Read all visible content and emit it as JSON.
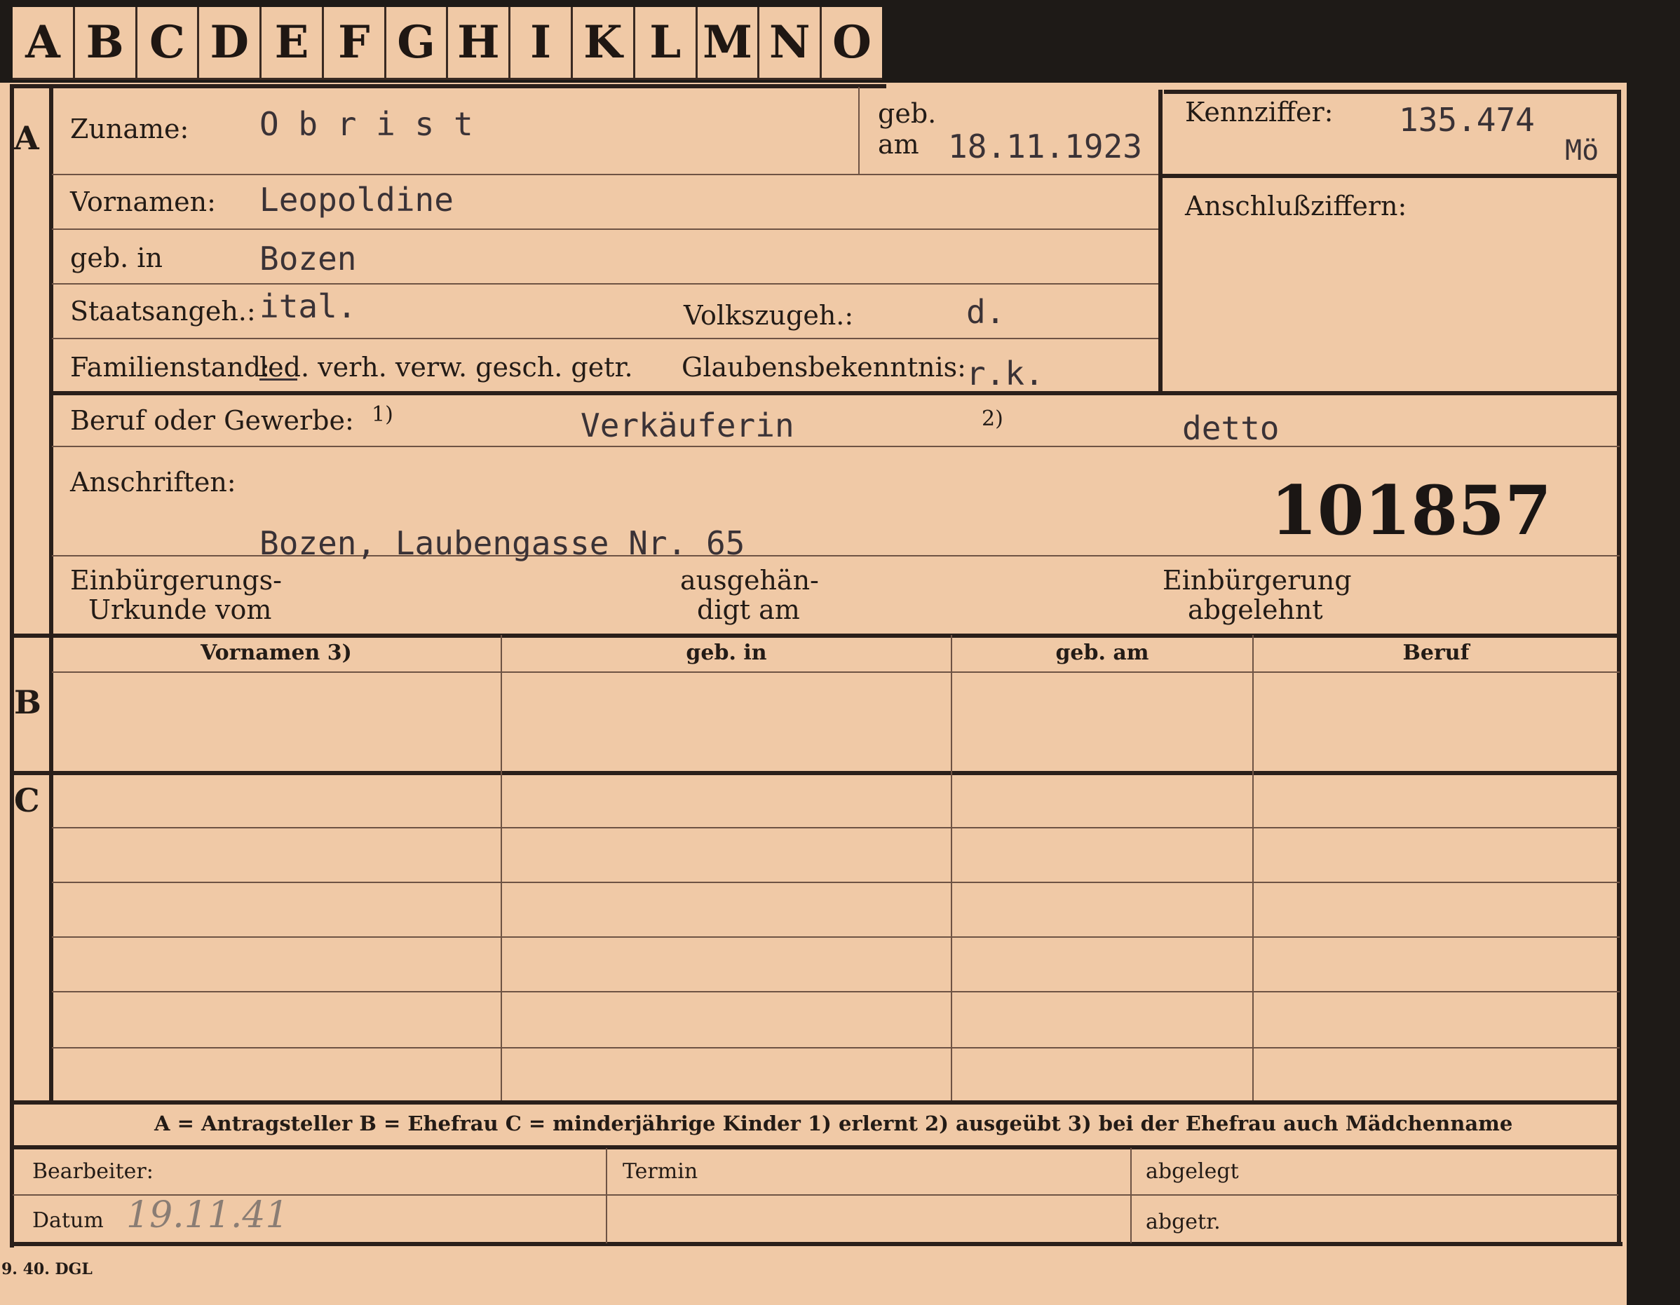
{
  "tabs": [
    "A",
    "B",
    "C",
    "D",
    "E",
    "F",
    "G",
    "H",
    "I",
    "K",
    "L",
    "M",
    "N",
    "O"
  ],
  "section_labels": {
    "a": "A",
    "b": "B",
    "c": "C"
  },
  "personal": {
    "zuname_label": "Zuname:",
    "zuname": "O b r i s t",
    "geb_label": "geb.",
    "am_label": "am",
    "geb_am": "18.11.1923",
    "kennziffer_label": "Kennziffer:",
    "kennziffer": "135.474",
    "kennziffer_suffix": "Mö",
    "anschluss_label": "Anschlußziffern:",
    "vornamen_label": "Vornamen:",
    "vornamen": "Leopoldine",
    "geb_in_label": "geb. in",
    "geb_in": "Bozen",
    "staat_label": "Staatsangeh.:",
    "staat": "ital.",
    "volk_label": "Volkszugeh.:",
    "volk": "d.",
    "familienstand_label": "Familienstand:",
    "familienstand_options": "led. verh. verw. gesch. getr.",
    "glauben_label": "Glaubensbekenntnis:",
    "glauben": "r.k.",
    "beruf_label": "Beruf oder Gewerbe:",
    "beruf_note1": "1)",
    "beruf1": "Verkäuferin",
    "beruf_note2": "2)",
    "beruf2": "detto",
    "anschriften_label": "Anschriften:",
    "anschrift": "Bozen, Laubengasse Nr. 65",
    "stamp_number": "101857",
    "einb_urkunde_l1": "Einbürgerungs-",
    "einb_urkunde_l2": "Urkunde vom",
    "ausgeh_l1": "ausgehän-",
    "ausgeh_l2": "digt am",
    "einb_abgelehnt_l1": "Einbürgerung",
    "einb_abgelehnt_l2": "abgelehnt"
  },
  "table": {
    "headers": [
      "Vornamen 3)",
      "geb. in",
      "geb. am",
      "Beruf"
    ]
  },
  "legend": "A = Antragsteller   B = Ehefrau   C = minderjährige Kinder   1) erlernt   2) ausgeübt   3) bei der Ehefrau auch Mädchenname",
  "footer": {
    "bearbeiter_label": "Bearbeiter:",
    "datum_label": "Datum",
    "datum_value": "19.11.41",
    "termin_label": "Termin",
    "abgelegt_label": "abgelegt",
    "abgetr_label": "abgetr.",
    "printer_mark": "9. 40. DGL"
  }
}
